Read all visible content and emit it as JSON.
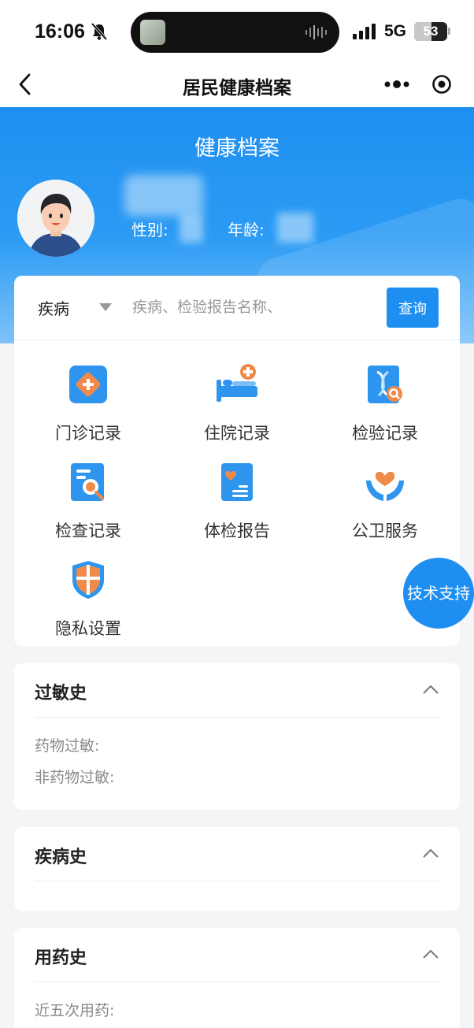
{
  "status": {
    "time": "16:06",
    "network": "5G",
    "battery": "53",
    "battery_level": 0.53
  },
  "nav": {
    "title": "居民健康档案"
  },
  "header": {
    "title": "健康档案",
    "gender_label": "性别:",
    "age_label": "年龄:"
  },
  "search": {
    "category": "疾病",
    "placeholder": "疾病、检验报告名称、",
    "button": "查询"
  },
  "grid": [
    {
      "label": "门诊记录",
      "icon": "outpatient-icon"
    },
    {
      "label": "住院记录",
      "icon": "hospital-bed-icon"
    },
    {
      "label": "检验记录",
      "icon": "dna-test-icon"
    },
    {
      "label": "检查记录",
      "icon": "exam-search-icon"
    },
    {
      "label": "体检报告",
      "icon": "checkup-report-icon"
    },
    {
      "label": "公卫服务",
      "icon": "heart-hands-icon"
    },
    {
      "label": "隐私设置",
      "icon": "shield-icon"
    }
  ],
  "fab": {
    "label": "技术支持"
  },
  "sections": {
    "allergy": {
      "title": "过敏史",
      "rows": [
        "药物过敏:",
        "非药物过敏:"
      ]
    },
    "disease": {
      "title": "疾病史"
    },
    "medication": {
      "title": "用药史",
      "rows": [
        "近五次用药:"
      ]
    }
  },
  "colors": {
    "primary": "#1e8ff0",
    "accent_orange": "#f08a4b"
  }
}
